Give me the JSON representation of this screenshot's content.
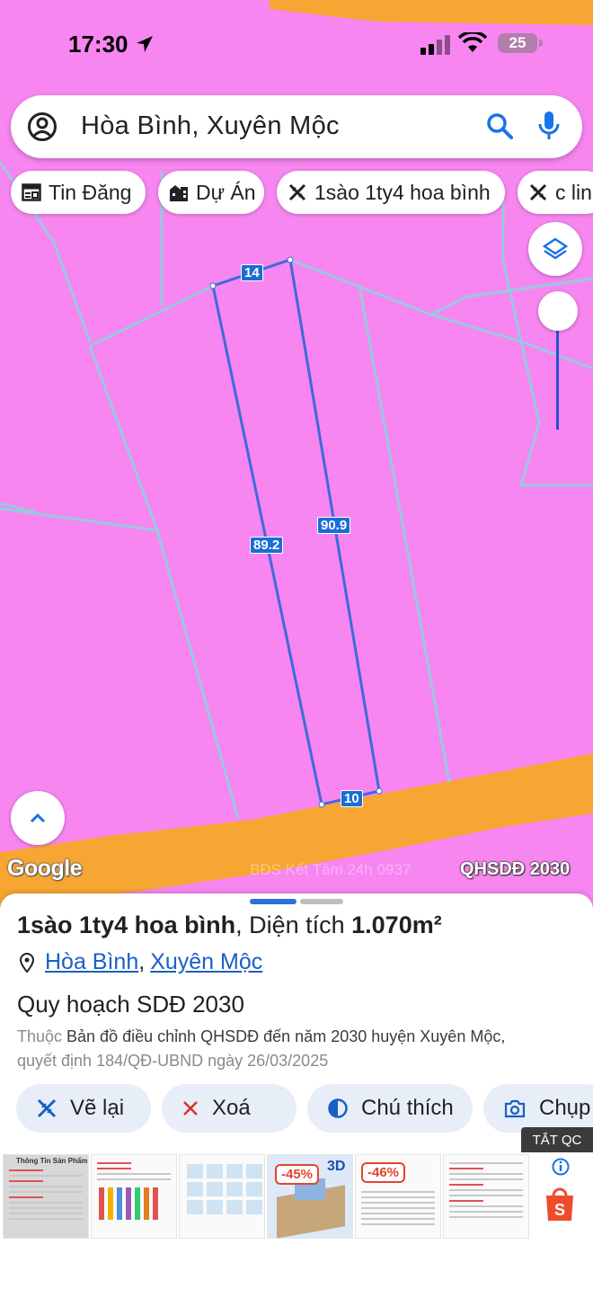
{
  "status_bar": {
    "time": "17:30",
    "battery": "25"
  },
  "search": {
    "query": "Hòa Bình, Xuyên Mộc"
  },
  "chips": [
    {
      "label": "Tin Đăng",
      "icon": "newspaper-icon"
    },
    {
      "label": "Dự Án",
      "icon": "building-icon"
    },
    {
      "label": "1sào 1ty4 hoa bình",
      "icon": "ruler-pencil-icon"
    },
    {
      "label": "c lin",
      "icon": "ruler-pencil-icon"
    }
  ],
  "map": {
    "measurements": {
      "top": "14",
      "left": "89.2",
      "right": "90.9",
      "bottom": "10"
    },
    "google": "Google",
    "watermark": "BĐS Kết Tầm 24h 0937",
    "layer_badge": "QHSDĐ 2030",
    "colors": {
      "land": "#f786f0",
      "road": "#f7a633",
      "parcel_line": "#3d6bd9"
    }
  },
  "sheet": {
    "title_name": "1sào 1ty4 hoa bình",
    "title_area_label": ", Diện tích ",
    "title_area_value": "1.070m²",
    "location": {
      "commune": "Hòa Bình",
      "separator": ",",
      "district": "Xuyên Mộc"
    },
    "plan_title": "Quy hoạch SDĐ 2030",
    "plan_desc_prefix": "Thuộc ",
    "plan_desc_line1": "Bản đồ điều chỉnh QHSDĐ đến năm 2030 huyện Xuyên Mộc,",
    "plan_desc_line2": "quyết định 184/QĐ-UBND ngày 26/03/2025",
    "actions": [
      {
        "label": "Vẽ lại",
        "icon": "redraw-icon"
      },
      {
        "label": "Xoá",
        "icon": "close-icon"
      },
      {
        "label": "Chú thích",
        "icon": "legend-icon"
      },
      {
        "label": "Chụp",
        "icon": "camera-icon"
      }
    ]
  },
  "ad": {
    "tag": "TẮT QC",
    "thumb1_caption": "Thông Tin Sản Phẩm",
    "discount_1": "-45%",
    "discount_2": "-46%",
    "badge_3d": "3D"
  }
}
